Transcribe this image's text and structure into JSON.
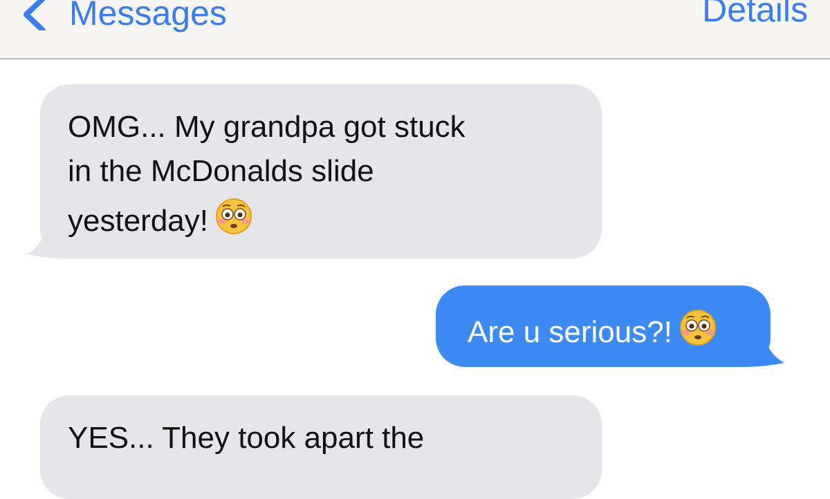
{
  "nav": {
    "back_label": "Messages",
    "back_icon": "chevron-left-icon",
    "details_label": "Details",
    "accent_color": "#3a7df0"
  },
  "messages": [
    {
      "direction": "incoming",
      "lines": [
        "OMG... My grandpa got stuck",
        "in the McDonalds slide",
        "yesterday!"
      ],
      "emoji": "flushed-face-emoji"
    },
    {
      "direction": "outgoing",
      "lines": [
        "Are u serious?!"
      ],
      "emoji": "flushed-face-emoji"
    },
    {
      "direction": "incoming",
      "lines": [
        "YES... They took apart the"
      ],
      "emoji": ""
    }
  ],
  "colors": {
    "incoming_bubble": "#e6e5ea",
    "outgoing_bubble": "#3d8bf2",
    "nav_background": "#f6f5f3"
  }
}
